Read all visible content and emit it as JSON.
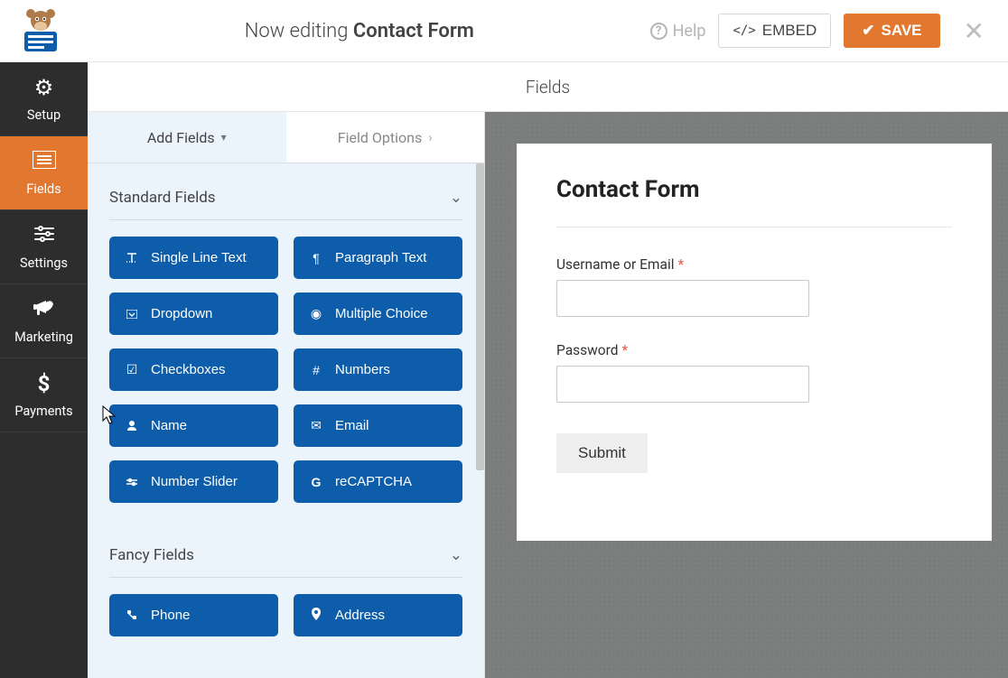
{
  "topbar": {
    "now_editing_prefix": "Now editing ",
    "form_name": "Contact Form",
    "help_label": "Help",
    "embed_label": "EMBED",
    "save_label": "SAVE"
  },
  "nav": {
    "items": [
      {
        "label": "Setup"
      },
      {
        "label": "Fields"
      },
      {
        "label": "Settings"
      },
      {
        "label": "Marketing"
      },
      {
        "label": "Payments"
      }
    ]
  },
  "panel": {
    "header": "Fields",
    "tab_add": "Add Fields",
    "tab_options": "Field Options",
    "section_standard": "Standard Fields",
    "section_fancy": "Fancy Fields",
    "standard_fields": [
      {
        "label": "Single Line Text",
        "icon": "T_"
      },
      {
        "label": "Paragraph Text",
        "icon": "¶"
      },
      {
        "label": "Dropdown",
        "icon": "▾"
      },
      {
        "label": "Multiple Choice",
        "icon": "◉"
      },
      {
        "label": "Checkboxes",
        "icon": "☑"
      },
      {
        "label": "Numbers",
        "icon": "#"
      },
      {
        "label": "Name",
        "icon": "👤"
      },
      {
        "label": "Email",
        "icon": "✉"
      },
      {
        "label": "Number Slider",
        "icon": "⇄"
      },
      {
        "label": "reCAPTCHA",
        "icon": "G"
      }
    ],
    "fancy_fields": [
      {
        "label": "Phone",
        "icon": "📞"
      },
      {
        "label": "Address",
        "icon": "📍"
      }
    ]
  },
  "preview": {
    "title": "Contact Form",
    "fields": [
      {
        "label": "Username or Email",
        "required": true
      },
      {
        "label": "Password",
        "required": true
      }
    ],
    "submit_label": "Submit"
  },
  "colors": {
    "orange": "#e27730",
    "field_blue": "#0d5daa",
    "panel_bg": "#ebf3fb"
  }
}
